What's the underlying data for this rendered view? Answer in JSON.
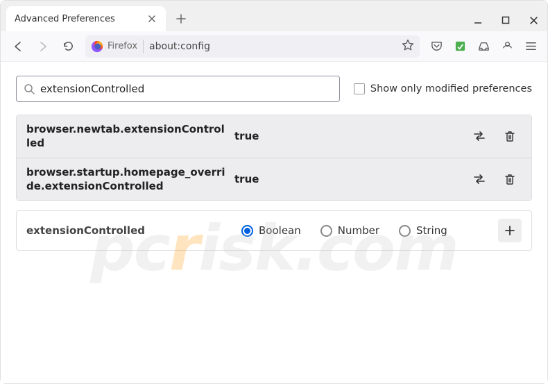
{
  "window": {
    "tab_title": "Advanced Preferences",
    "minimize": "—",
    "maximize": "☐",
    "close": "✕"
  },
  "toolbar": {
    "identity_label": "Firefox",
    "url": "about:config"
  },
  "search": {
    "value": "extensionControlled",
    "checkbox_label": "Show only modified preferences"
  },
  "prefs": [
    {
      "name": "browser.newtab.extensionControlled",
      "value": "true"
    },
    {
      "name": "browser.startup.homepage_override.extensionControlled",
      "value": "true"
    }
  ],
  "newpref": {
    "name": "extensionControlled",
    "options": {
      "boolean": "Boolean",
      "number": "Number",
      "string": "String"
    }
  }
}
